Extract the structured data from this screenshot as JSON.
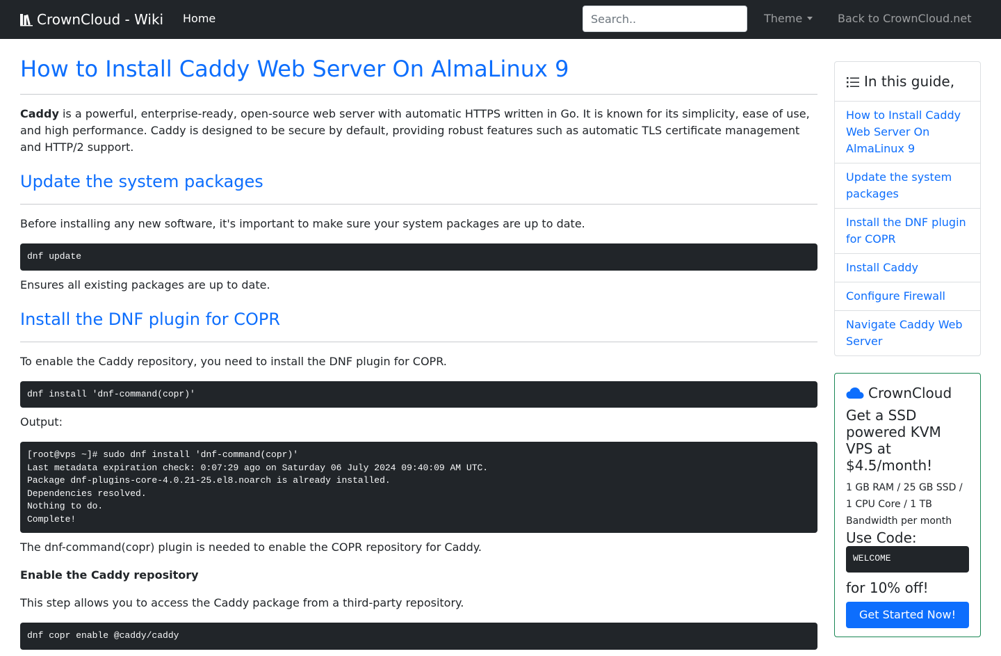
{
  "navbar": {
    "brand": "CrownCloud - Wiki",
    "home": "Home",
    "search_placeholder": "Search..",
    "theme": "Theme",
    "back": "Back to CrownCloud.net"
  },
  "article": {
    "title": "How to Install Caddy Web Server On AlmaLinux 9",
    "intro_bold": "Caddy",
    "intro_rest": " is a powerful, enterprise-ready, open-source web server with automatic HTTPS written in Go. It is known for its simplicity, ease of use, and high performance. Caddy is designed to be secure by default, providing robust features such as automatic TLS certificate management and HTTP/2 support.",
    "sections": [
      {
        "heading": "Update the system packages",
        "text": "Before installing any new software, it's important to make sure your system packages are up to date.",
        "code": "dnf update",
        "note": "Ensures all existing packages are up to date."
      },
      {
        "heading": "Install the DNF plugin for COPR",
        "text": "To enable the Caddy repository, you need to install the DNF plugin for COPR.",
        "code": "dnf install 'dnf-command(copr)'",
        "output_label": "Output:",
        "output": "[root@vps ~]# sudo dnf install 'dnf-command(copr)'\nLast metadata expiration check: 0:07:29 ago on Saturday 06 July 2024 09:40:09 AM UTC.\nPackage dnf-plugins-core-4.0.21-25.el8.noarch is already installed.\nDependencies resolved.\nNothing to do.\nComplete!",
        "note": "The dnf-command(copr) plugin is needed to enable the COPR repository for Caddy."
      }
    ],
    "enable_heading": "Enable the Caddy repository",
    "enable_text": "This step allows you to access the Caddy package from a third-party repository.",
    "enable_code": "dnf copr enable @caddy/caddy"
  },
  "toc": {
    "title": "In this guide,",
    "items": [
      "How to Install Caddy Web Server On AlmaLinux 9",
      "Update the system packages",
      "Install the DNF plugin for COPR",
      "Install Caddy",
      "Configure Firewall",
      "Navigate Caddy Web Server"
    ]
  },
  "ad": {
    "title": "CrownCloud",
    "headline": "Get a SSD powered KVM VPS at $4.5/month!",
    "specs": "1 GB RAM / 25 GB SSD / 1 CPU Core / 1 TB Bandwidth per month",
    "use_code": "Use Code:",
    "code": "WELCOME",
    "discount": "for 10% off!",
    "button": "Get Started Now!"
  },
  "colors": {
    "navbar_bg": "#212529",
    "link": "#0d6efd",
    "code_bg": "#212529",
    "ad_border": "#198754",
    "cloud_icon": "#0d6efd"
  }
}
